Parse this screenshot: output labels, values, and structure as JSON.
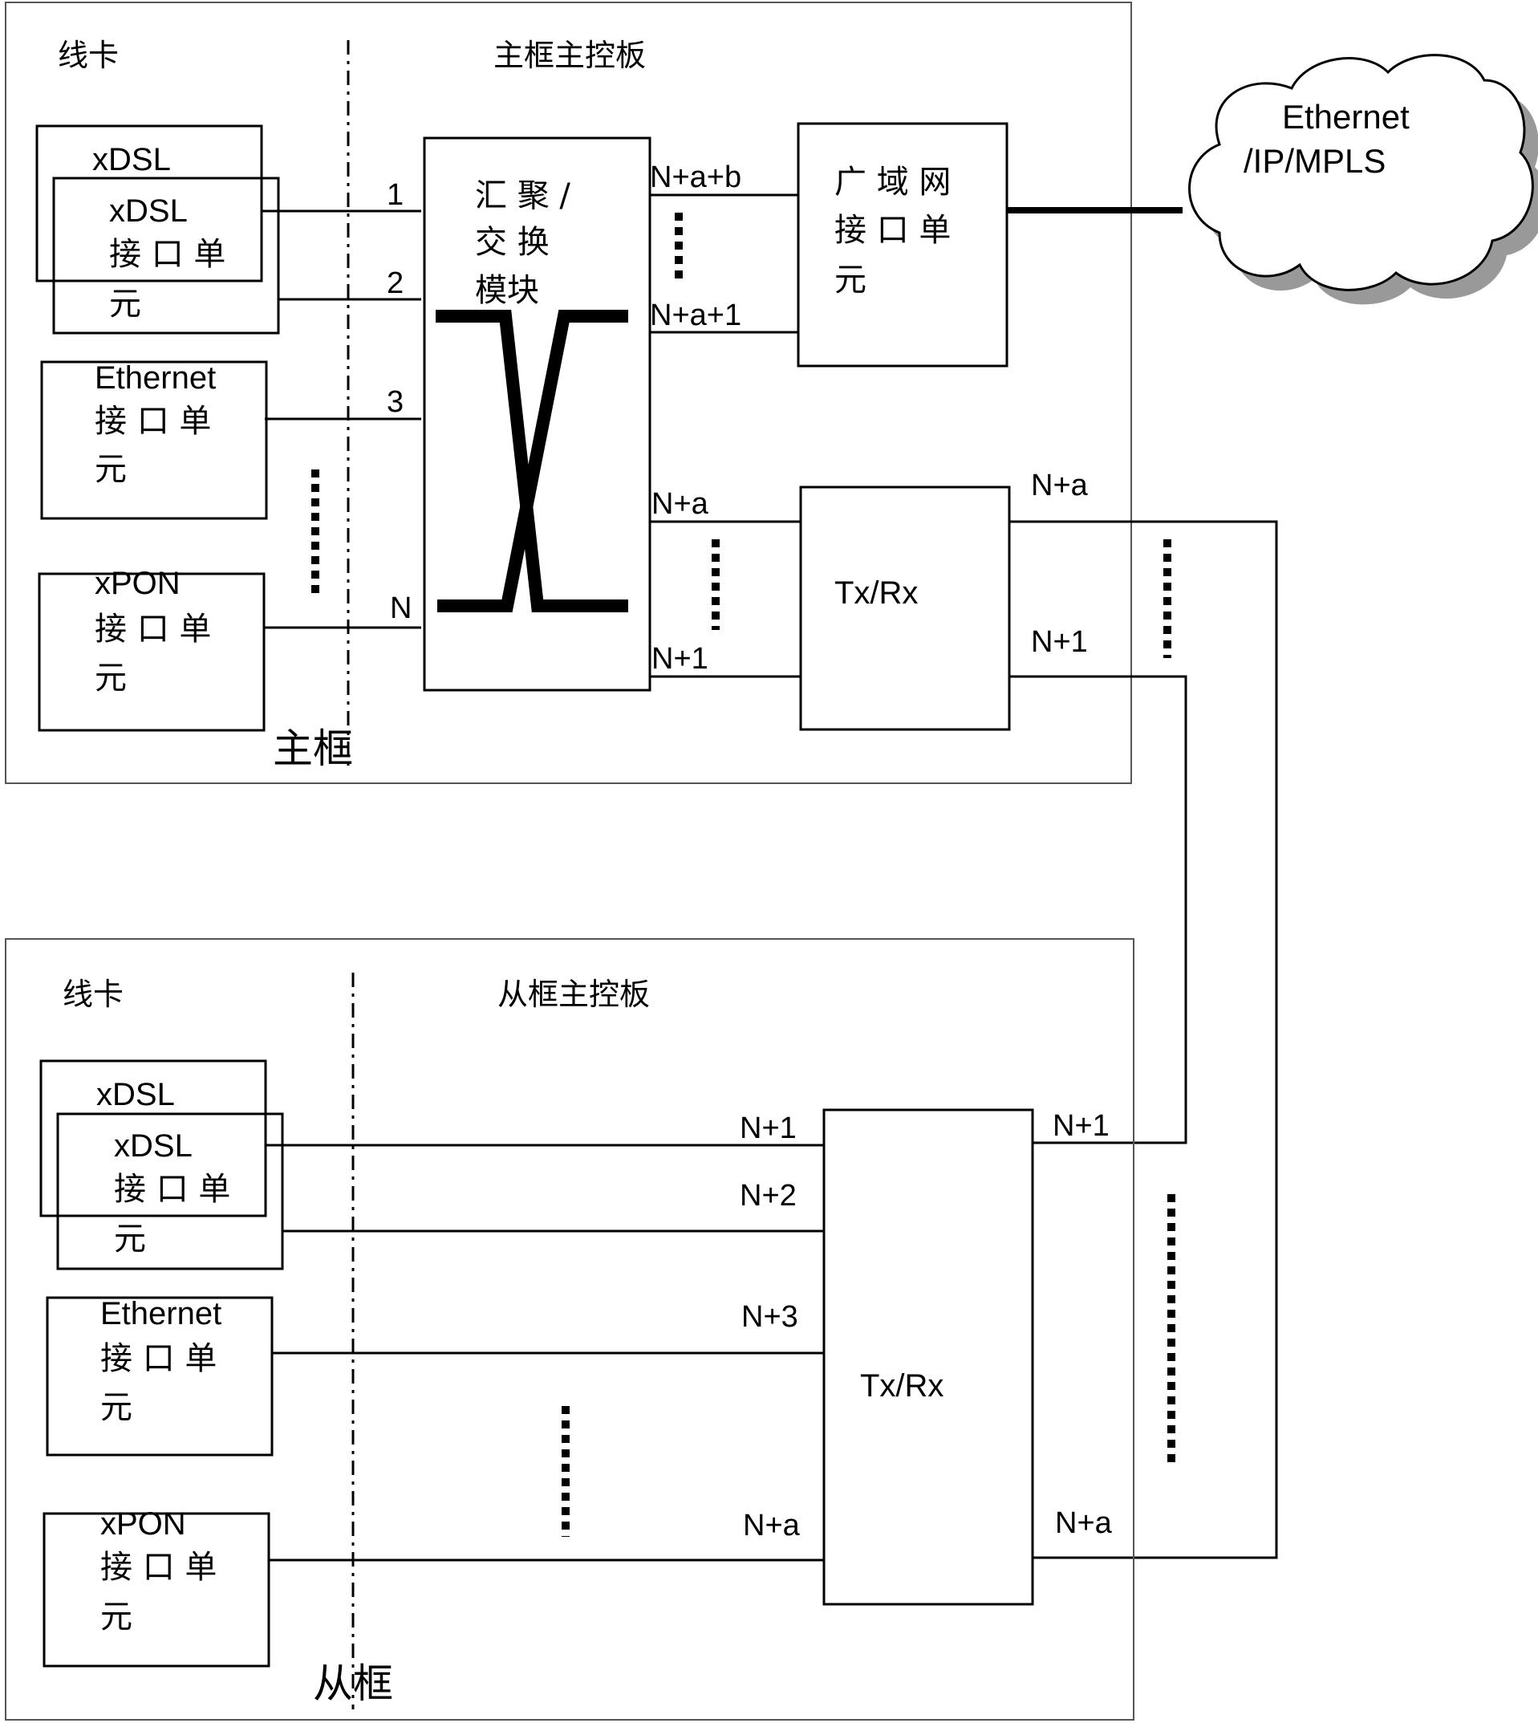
{
  "main_frame": {
    "label": "主框",
    "line_card_header": "线卡",
    "control_board_header": "主框主控板",
    "cards": [
      {
        "top": "xDSL",
        "label": [
          "xDSL",
          "接 口 单",
          "元"
        ]
      },
      {
        "label": [
          "Ethernet",
          "接 口 单",
          "元"
        ]
      },
      {
        "label": [
          "xPON",
          "接 口 单",
          "元"
        ]
      }
    ],
    "port_labels": [
      "1",
      "2",
      "3",
      "N"
    ],
    "switch_module": [
      "汇 聚 /",
      "交   换",
      "模块"
    ],
    "wan_unit": [
      "广 域 网",
      "接 口 单",
      "元"
    ],
    "wan_ports": [
      "N+a+b",
      "N+a+1"
    ],
    "txrx": "Tx/Rx",
    "txrx_in_ports": [
      "N+a",
      "N+1"
    ],
    "txrx_out_ports": [
      "N+a",
      "N+1"
    ]
  },
  "cloud": {
    "line1": "Ethernet",
    "line2": "/IP/MPLS"
  },
  "slave_frame": {
    "label": "从框",
    "line_card_header": "线卡",
    "control_board_header": "从框主控板",
    "cards": [
      {
        "top": "xDSL",
        "label": [
          "xDSL",
          "接 口 单",
          "元"
        ]
      },
      {
        "label": [
          "Ethernet",
          "接 口 单",
          "元"
        ]
      },
      {
        "label": [
          "xPON",
          "接 口 单",
          "元"
        ]
      }
    ],
    "txrx": "Tx/Rx",
    "in_ports": [
      "N+1",
      "N+2",
      "N+3",
      "N+a"
    ],
    "out_ports": [
      "N+1",
      "N+a"
    ]
  }
}
